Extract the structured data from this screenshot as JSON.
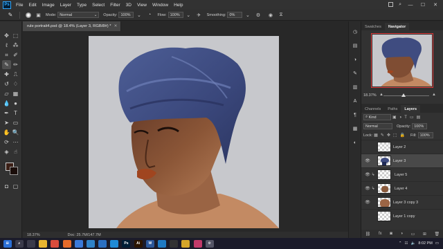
{
  "app": {
    "logo": "Ps"
  },
  "menu": [
    "File",
    "Edit",
    "Image",
    "Layer",
    "Type",
    "Select",
    "Filter",
    "3D",
    "View",
    "Window",
    "Help"
  ],
  "options": {
    "mode_label": "Mode:",
    "mode_value": "Normal",
    "opacity_label": "Opacity:",
    "opacity_value": "100%",
    "flow_label": "Flow:",
    "flow_value": "100%",
    "smoothing_label": "Smoothing:",
    "smoothing_value": "0%"
  },
  "document": {
    "tab_title": "rule portrait4.psd @ 18.4% (Layer 3, RGB/8#) *",
    "zoom": "18.37%",
    "doc_size": "Doc: 25.7M/147.7M"
  },
  "colors": {
    "foreground": "#3b1f16",
    "background": "#1a0d0a",
    "accent": "#31a8ff",
    "navigator_frame": "#e03a3a"
  },
  "navigator": {
    "tabs": [
      {
        "label": "Swatches",
        "active": false
      },
      {
        "label": "Navigator",
        "active": true
      }
    ],
    "zoom": "18.37%"
  },
  "layers_panel": {
    "tabs": [
      {
        "label": "Channels",
        "active": false
      },
      {
        "label": "Paths",
        "active": false
      },
      {
        "label": "Layers",
        "active": true
      }
    ],
    "filter_label": "Kind",
    "blend_mode": "Normal",
    "opacity_label": "Opacity:",
    "opacity_value": "100%",
    "lock_label": "Lock:",
    "fill_label": "Fill:",
    "fill_value": "100%",
    "layers": [
      {
        "name": "Layer 2",
        "visible": false,
        "selected": false,
        "clipped": false,
        "thumb": "empty"
      },
      {
        "name": "Layer 3",
        "visible": true,
        "selected": true,
        "clipped": false,
        "thumb": "turban"
      },
      {
        "name": "Layer 5",
        "visible": true,
        "selected": false,
        "clipped": true,
        "thumb": "empty"
      },
      {
        "name": "Layer 4",
        "visible": true,
        "selected": false,
        "clipped": true,
        "thumb": "hair"
      },
      {
        "name": "Layer 3 copy 3",
        "visible": true,
        "selected": false,
        "clipped": false,
        "thumb": "skin"
      },
      {
        "name": "Layer 1 copy",
        "visible": false,
        "selected": false,
        "clipped": false,
        "thumb": "empty"
      }
    ]
  },
  "taskbar": {
    "apps": [
      "start",
      "search",
      "task-view",
      "explorer",
      "chrome",
      "firefox",
      "store",
      "photos",
      "mail",
      "edge",
      "photoshop",
      "illustrator",
      "word",
      "vscode",
      "terminal",
      "files",
      "music",
      "settings"
    ],
    "time": "8:02 PM"
  }
}
